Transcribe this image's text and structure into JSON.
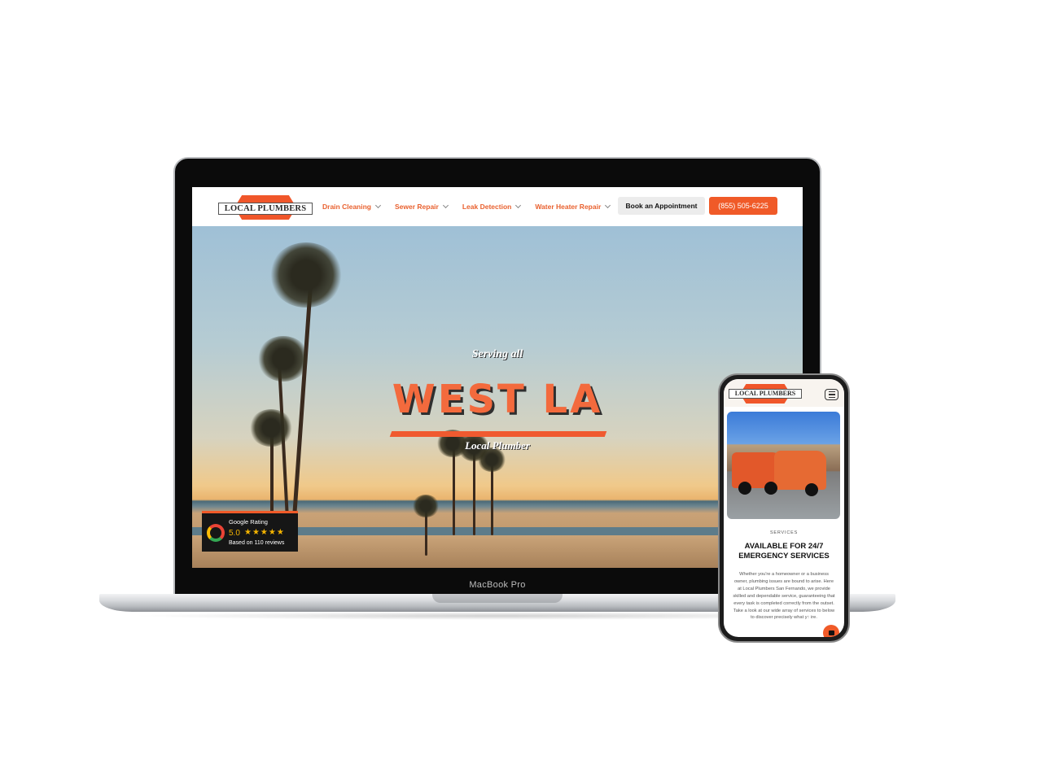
{
  "laptop": {
    "model_label": "MacBook Pro",
    "site": {
      "logo_text": "LOCAL PLUMBERS",
      "nav": [
        {
          "label": "Drain Cleaning"
        },
        {
          "label": "Sewer Repair"
        },
        {
          "label": "Leak Detection"
        },
        {
          "label": "Water Heater Repair"
        }
      ],
      "appointment_button": "Book an Appointment",
      "phone_button": "(855) 505-6225",
      "hero": {
        "pretitle": "Serving all",
        "title": "WEST LA",
        "subtitle": "Local Plumber"
      },
      "rating": {
        "label": "Google Rating",
        "score": "5.0",
        "stars": "★★★★★",
        "reviews": "Based on 110 reviews"
      }
    }
  },
  "phone": {
    "logo_text": "LOCAL PLUMBERS",
    "kicker": "SERVICES",
    "title_line1": "AVAILABLE FOR 24/7",
    "title_line2": "EMERGENCY SERVICES",
    "body": "Whether you're a homeowner or a business owner, plumbing issues are bound to arise. Here at Local Plumbers San Fernando, we provide skilled and dependable service, guaranteeing that every task is completed correctly from the outset. Take a look at our wide array of services to below to discover precisely what y↑ ire."
  },
  "colors": {
    "brand_orange": "#f05a28",
    "nav_orange": "#e9612f"
  }
}
